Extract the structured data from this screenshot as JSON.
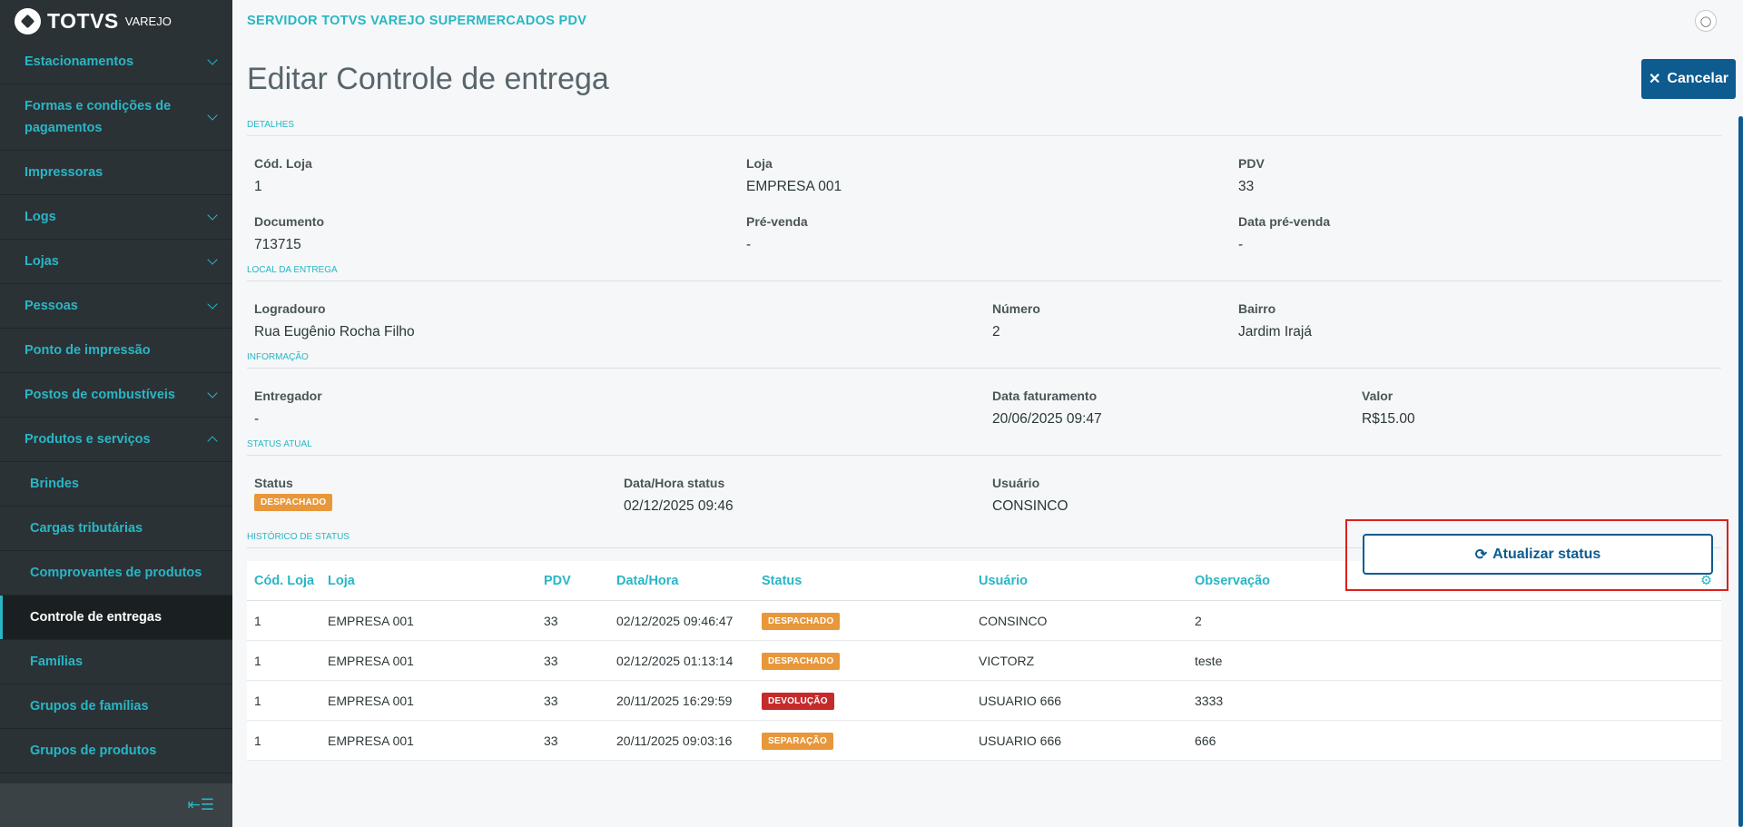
{
  "brand": {
    "name": "TOTVS",
    "sub": "VAREJO"
  },
  "sidebar": {
    "items": [
      {
        "label": "Estacionamentos",
        "chevron": "down"
      },
      {
        "label": "Formas e condições de pagamentos",
        "chevron": "down"
      },
      {
        "label": "Impressoras",
        "chevron": ""
      },
      {
        "label": "Logs",
        "chevron": "down"
      },
      {
        "label": "Lojas",
        "chevron": "down"
      },
      {
        "label": "Pessoas",
        "chevron": "down"
      },
      {
        "label": "Ponto de impressão",
        "chevron": ""
      },
      {
        "label": "Postos de combustíveis",
        "chevron": "down"
      },
      {
        "label": "Produtos e serviços",
        "chevron": "up"
      }
    ],
    "subitems": [
      {
        "label": "Brindes"
      },
      {
        "label": "Cargas tributárias"
      },
      {
        "label": "Comprovantes de produtos"
      },
      {
        "label": "Controle de entregas",
        "active": true
      },
      {
        "label": "Famílias"
      },
      {
        "label": "Grupos de famílias"
      },
      {
        "label": "Grupos de produtos"
      }
    ]
  },
  "header": {
    "server": "SERVIDOR TOTVS VAREJO SUPERMERCADOS PDV"
  },
  "page": {
    "title": "Editar Controle de entrega",
    "cancel_label": "Cancelar"
  },
  "detalhes": {
    "section": "DETALHES",
    "cod_loja_label": "Cód. Loja",
    "cod_loja": "1",
    "loja_label": "Loja",
    "loja": "EMPRESA 001",
    "pdv_label": "PDV",
    "pdv": "33",
    "documento_label": "Documento",
    "documento": "713715",
    "prevenda_label": "Pré-venda",
    "prevenda": "-",
    "data_prevenda_label": "Data pré-venda",
    "data_prevenda": "-"
  },
  "local": {
    "section": "LOCAL DA ENTREGA",
    "logradouro_label": "Logradouro",
    "logradouro": "Rua Eugênio Rocha Filho",
    "numero_label": "Número",
    "numero": "2",
    "bairro_label": "Bairro",
    "bairro": "Jardim Irajá"
  },
  "informacao": {
    "section": "INFORMAÇÃO",
    "entregador_label": "Entregador",
    "entregador": "-",
    "data_fat_label": "Data faturamento",
    "data_fat": "20/06/2025 09:47",
    "valor_label": "Valor",
    "valor": "R$15.00"
  },
  "status_atual": {
    "section": "STATUS ATUAL",
    "status_label": "Status",
    "status": "DESPACHADO",
    "data_label": "Data/Hora status",
    "data": "02/12/2025 09:46",
    "usuario_label": "Usuário",
    "usuario": "CONSINCO",
    "update_label": "Atualizar status"
  },
  "historico": {
    "section": "HISTÓRICO DE STATUS",
    "columns": [
      "Cód. Loja",
      "Loja",
      "PDV",
      "Data/Hora",
      "Status",
      "Usuário",
      "Observação"
    ],
    "rows": [
      {
        "cod": "1",
        "loja": "EMPRESA 001",
        "pdv": "33",
        "data": "02/12/2025 09:46:47",
        "status": "DESPACHADO",
        "usuario": "CONSINCO",
        "obs": "2"
      },
      {
        "cod": "1",
        "loja": "EMPRESA 001",
        "pdv": "33",
        "data": "02/12/2025 01:13:14",
        "status": "DESPACHADO",
        "usuario": "VICTORZ",
        "obs": "teste"
      },
      {
        "cod": "1",
        "loja": "EMPRESA 001",
        "pdv": "33",
        "data": "20/11/2025 16:29:59",
        "status": "DEVOLUÇÃO",
        "usuario": "USUARIO 666",
        "obs": "3333"
      },
      {
        "cod": "1",
        "loja": "EMPRESA 001",
        "pdv": "33",
        "data": "20/11/2025 09:03:16",
        "status": "SEPARAÇÃO",
        "usuario": "USUARIO 666",
        "obs": "666"
      }
    ]
  },
  "colors": {
    "accent": "#29b6c5",
    "primary": "#0d5b8f",
    "sidebar": "#2b3236",
    "highlight": "#dc1f1f"
  }
}
